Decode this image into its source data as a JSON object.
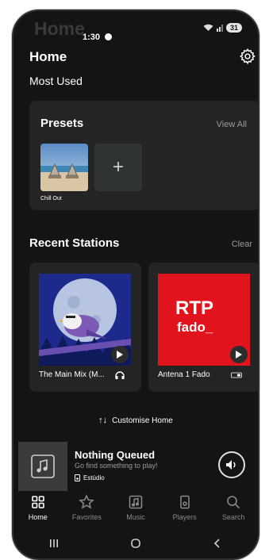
{
  "status_bar": {
    "time": "1:30",
    "ghost_title": "Home",
    "battery": "31"
  },
  "header": {
    "title": "Home"
  },
  "sections": {
    "most_used": "Most Used"
  },
  "presets": {
    "title": "Presets",
    "view_all": "View All",
    "items": [
      {
        "label": "Chill Out"
      }
    ],
    "add_symbol": "+"
  },
  "recent": {
    "title": "Recent Stations",
    "clear": "Clear",
    "stations": [
      {
        "name": "The Main Mix (M..."
      },
      {
        "name": "Antena 1 Fado"
      }
    ],
    "rtp_logo": "RTP",
    "rtp_sub": "fado_"
  },
  "customise": {
    "label": "Customise Home"
  },
  "now_playing": {
    "title": "Nothing Queued",
    "subtitle": "Go find something to play!",
    "room": "Estúdio"
  },
  "tabs": [
    {
      "label": "Home",
      "icon": "grid-icon",
      "active": true
    },
    {
      "label": "Favorites",
      "icon": "star-icon"
    },
    {
      "label": "Music",
      "icon": "music-icon"
    },
    {
      "label": "Players",
      "icon": "speaker-icon"
    },
    {
      "label": "Search",
      "icon": "search-icon"
    }
  ],
  "colors": {
    "background": "#141414",
    "card": "#242424",
    "rtp_red": "#e1141d",
    "text_secondary": "#9a9a9a"
  }
}
